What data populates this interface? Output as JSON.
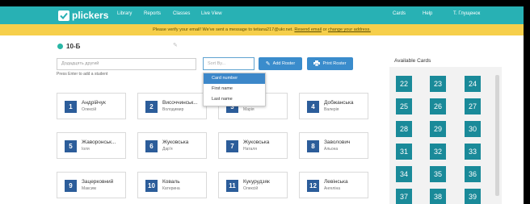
{
  "nav": {
    "logo": "plickers",
    "links": [
      "Library",
      "Reports",
      "Classes",
      "Live View"
    ],
    "right_links": [
      "Cards",
      "Help",
      "T. Глущенок"
    ]
  },
  "banner": {
    "prefix": "Please verify your email! We've sent a message to tetiana217@ukr.net.",
    "resend": "Resend email",
    "or": "or",
    "change": "change your address."
  },
  "class": {
    "name": "10-Б"
  },
  "add_student": {
    "placeholder": "Додадцять другий",
    "hint": "Press Enter to add a student"
  },
  "sort": {
    "placeholder": "Sort By..."
  },
  "buttons": {
    "add_roster": "Add Roster",
    "print_roster": "Print Roster"
  },
  "sort_options": [
    {
      "label": "Card number",
      "selected": true
    },
    {
      "label": "First name",
      "selected": false
    },
    {
      "label": "Last name",
      "selected": false
    }
  ],
  "students": [
    {
      "number": "1",
      "last": "Андрійчук",
      "first": "Олексій"
    },
    {
      "number": "2",
      "last": "Височчинськ...",
      "first": "Володимир"
    },
    {
      "number": "3",
      "last": "",
      "first": "Марія"
    },
    {
      "number": "4",
      "last": "Добжанська",
      "first": "Валерія"
    },
    {
      "number": "5",
      "last": "Жаворонськ...",
      "first": "Іоля"
    },
    {
      "number": "6",
      "last": "Жуковська",
      "first": "Дар'я"
    },
    {
      "number": "7",
      "last": "Жуковська",
      "first": "Наталя"
    },
    {
      "number": "8",
      "last": "Заволович",
      "first": "Альона"
    },
    {
      "number": "9",
      "last": "Зацерковний",
      "first": "Максим"
    },
    {
      "number": "10",
      "last": "Коваль",
      "first": "Катерина"
    },
    {
      "number": "11",
      "last": "Кукурудзяк",
      "first": "Олексій"
    },
    {
      "number": "12",
      "last": "Левінська",
      "first": "Ангеліна"
    }
  ],
  "available": {
    "title": "Available Cards",
    "cards": [
      "22",
      "23",
      "24",
      "25",
      "26",
      "27",
      "28",
      "29",
      "30",
      "31",
      "32",
      "33",
      "34",
      "35",
      "36",
      "37",
      "38",
      "39"
    ]
  },
  "colors": {
    "nav": "#28b1b4",
    "banner": "#f6cf4b",
    "button": "#3a8ccc",
    "badge": "#2c5d9a",
    "tile": "#1a8a99"
  }
}
